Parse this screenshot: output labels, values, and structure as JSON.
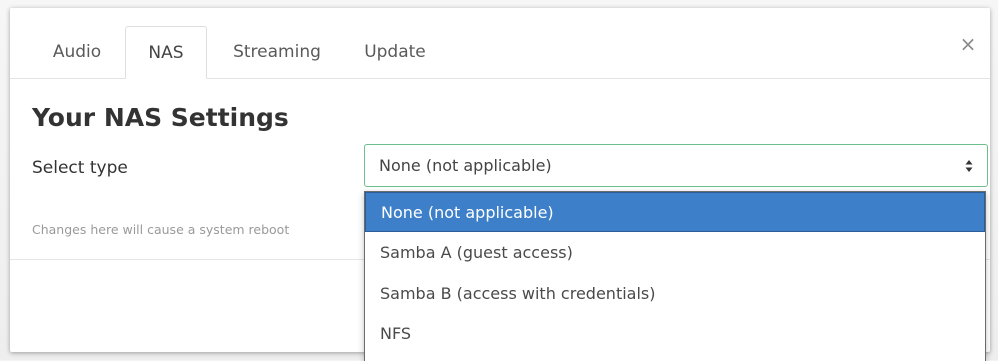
{
  "tabs": [
    {
      "label": "Audio",
      "active": false
    },
    {
      "label": "NAS",
      "active": true
    },
    {
      "label": "Streaming",
      "active": false
    },
    {
      "label": "Update",
      "active": false
    }
  ],
  "close": {
    "glyph": "×",
    "icon": "close-icon"
  },
  "settings": {
    "title": "Your NAS Settings",
    "type_label": "Select type",
    "hint": "Changes here will cause a system reboot",
    "select": {
      "value": "None (not applicable)",
      "icon": "sort-arrows-icon",
      "options": [
        "None (not applicable)",
        "Samba A (guest access)",
        "Samba B (access with credentials)",
        "NFS"
      ],
      "highlighted_index": 0
    }
  },
  "colors": {
    "selected_option": "#3d7fc9",
    "select_border": "#6cc08b"
  }
}
